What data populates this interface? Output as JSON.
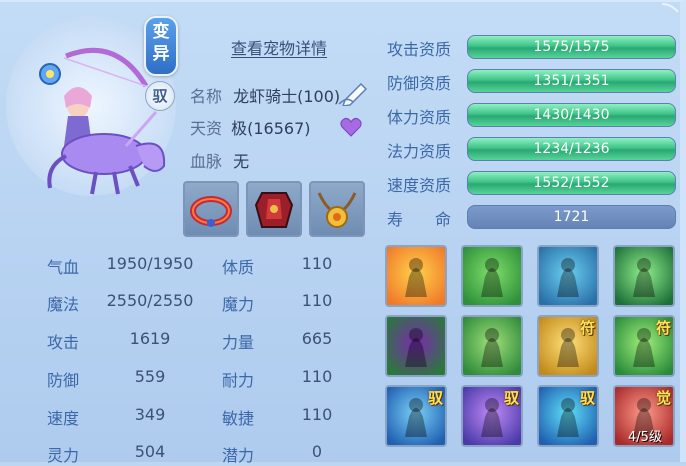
{
  "pet": {
    "variant_badge": "变异",
    "ride_badge": "驭",
    "details_link": "查看宠物详情",
    "name_label": "名称",
    "name_value": "龙虾骑士(100)",
    "talent_label": "天资",
    "talent_value": "极(16567)",
    "bloodline_label": "血脉",
    "bloodline_value": "无"
  },
  "equipment": [
    {
      "name": "collar-icon"
    },
    {
      "name": "armor-icon"
    },
    {
      "name": "amulet-icon"
    }
  ],
  "stats_left": [
    {
      "label": "气血",
      "value": "1950/1950"
    },
    {
      "label": "魔法",
      "value": "2550/2550"
    },
    {
      "label": "攻击",
      "value": "1619"
    },
    {
      "label": "防御",
      "value": "559"
    },
    {
      "label": "速度",
      "value": "349"
    },
    {
      "label": "灵力",
      "value": "504"
    }
  ],
  "stats_right": [
    {
      "label": "体质",
      "value": "110"
    },
    {
      "label": "魔力",
      "value": "110"
    },
    {
      "label": "力量",
      "value": "665"
    },
    {
      "label": "耐力",
      "value": "110"
    },
    {
      "label": "敏捷",
      "value": "110"
    },
    {
      "label": "潜力",
      "value": "0"
    }
  ],
  "aptitudes": [
    {
      "label": "攻击资质",
      "value": "1575/1575",
      "fill": 1.0
    },
    {
      "label": "防御资质",
      "value": "1351/1351",
      "fill": 1.0
    },
    {
      "label": "体力资质",
      "value": "1430/1430",
      "fill": 1.0
    },
    {
      "label": "法力资质",
      "value": "1234/1236",
      "fill": 0.998
    },
    {
      "label": "速度资质",
      "value": "1552/1552",
      "fill": 1.0
    }
  ],
  "life": {
    "label": "寿　　命",
    "value": "1721"
  },
  "skills": [
    {
      "name": "skill-flame-sword-icon",
      "tag": "",
      "level": ""
    },
    {
      "name": "skill-green-golem-icon",
      "tag": "",
      "level": ""
    },
    {
      "name": "skill-spirit-figure-icon",
      "tag": "",
      "level": ""
    },
    {
      "name": "skill-shield-warrior-icon",
      "tag": "",
      "level": ""
    },
    {
      "name": "skill-demon-wing-icon",
      "tag": "",
      "level": ""
    },
    {
      "name": "skill-strong-body-icon",
      "tag": "",
      "level": ""
    },
    {
      "name": "skill-talisman-icon",
      "tag": "符",
      "level": ""
    },
    {
      "name": "skill-green-fighter-icon",
      "tag": "符",
      "level": ""
    },
    {
      "name": "skill-water-ride-icon",
      "tag": "驭",
      "level": ""
    },
    {
      "name": "skill-purple-claw-icon",
      "tag": "驭",
      "level": ""
    },
    {
      "name": "skill-dash-icon",
      "tag": "驭",
      "level": ""
    },
    {
      "name": "skill-awaken-icon",
      "tag": "觉",
      "level": "4/5级"
    }
  ]
}
